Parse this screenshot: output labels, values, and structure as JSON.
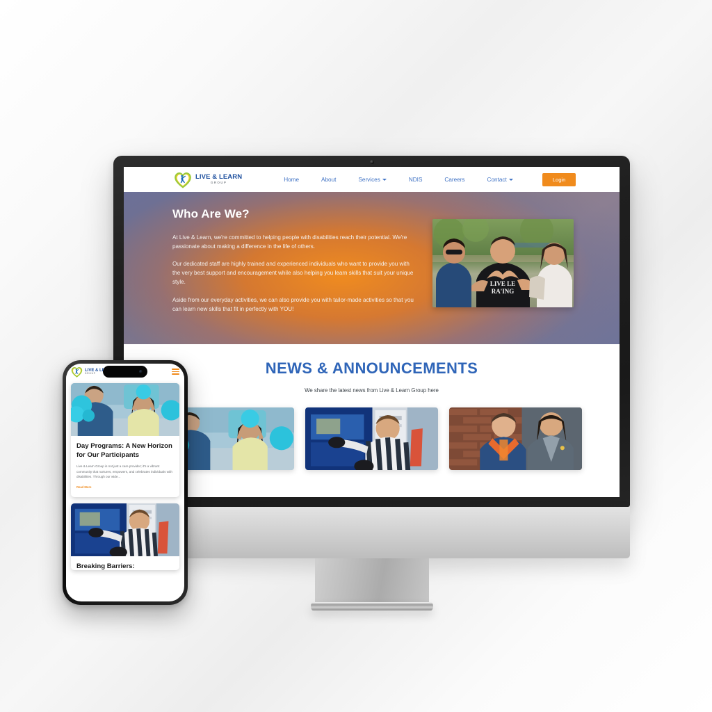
{
  "scene": {
    "description": "Responsive website mockup on desktop monitor and smartphone",
    "background_color": "#f2f2f2"
  },
  "brand": {
    "name_main": "LIVE & LEARN",
    "name_sub": "GROUP",
    "logo_icon": "heart-with-person-icon",
    "primary_blue": "#1d4f9e",
    "accent_orange": "#f08b1d",
    "logo_yellow": "#f6d32d",
    "logo_green": "#9cc93b"
  },
  "desktop": {
    "nav": {
      "items": [
        {
          "label": "Home",
          "has_dropdown": false
        },
        {
          "label": "About",
          "has_dropdown": false
        },
        {
          "label": "Services",
          "has_dropdown": true
        },
        {
          "label": "NDIS",
          "has_dropdown": false
        },
        {
          "label": "Careers",
          "has_dropdown": false
        },
        {
          "label": "Contact",
          "has_dropdown": true
        }
      ],
      "login_label": "Login"
    },
    "hero": {
      "title": "Who Are We?",
      "paragraph1": "At Live & Learn, we're committed to helping people with disabilities reach their potential. We're passionate about making a difference in the life of others.",
      "paragraph2": "Our dedicated staff are highly trained and experienced individuals who want to provide you with the very best support and encouragement while also helping you learn skills that suit your unique style.",
      "paragraph3": "Aside from our everyday activities, we can also provide you with tailor-made activities so that you can learn new skills that fit in perfectly with YOU!",
      "photo_alt": "Three people outdoors forming a heart shape with their hands"
    },
    "news": {
      "title": "NEWS & ANNOUNCEMENTS",
      "subtitle": "We share the latest news from Live & Learn Group here",
      "cards": [
        {
          "image_alt": "Two participants dancing with blue pom poms"
        },
        {
          "image_alt": "Participant using a touch screen display"
        },
        {
          "image_alt": "Two participants standing in front of a brick wall"
        }
      ]
    }
  },
  "mobile": {
    "nav": {
      "menu_icon": "hamburger-menu-icon"
    },
    "cards": [
      {
        "image_alt": "Two participants dancing with blue pom poms",
        "title": "Day Programs: A New Horizon for Our Participants",
        "excerpt": "Live & Learn Group is not just a care provider; it's a vibrant community that nurtures, empowers, and celebrates individuals with disabilities. Through our wide...",
        "read_more": "Read More"
      },
      {
        "image_alt": "Participant using a touch screen display",
        "title": "Breaking Barriers:"
      }
    ]
  }
}
